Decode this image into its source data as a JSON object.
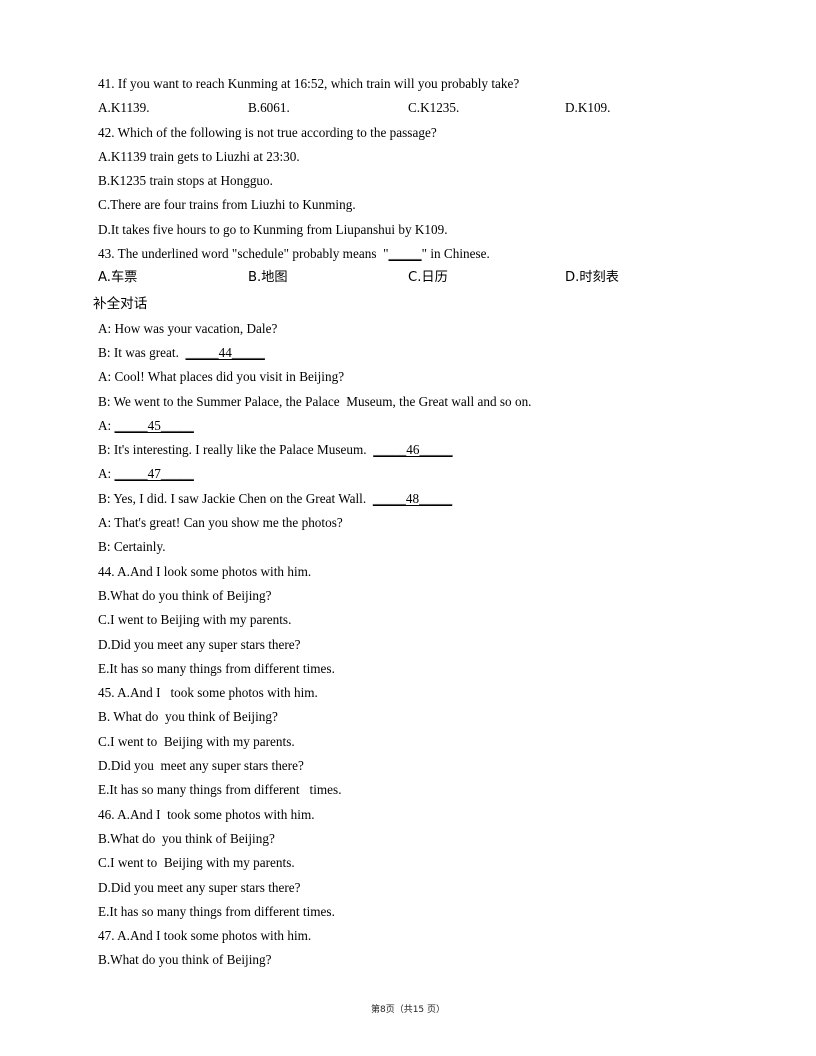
{
  "document": {
    "footer": "第8页（共15 页）"
  },
  "questions": {
    "q41": {
      "stem": "41. If you want to reach Kunming at 16:52, which train will you probably take?",
      "options": [
        "A.K1139.",
        "B.6061.",
        "C.K1235.",
        "D.K109."
      ]
    },
    "q42": {
      "stem": "42. Which of the following is not true according to the passage?",
      "options": [
        "A.K1139 train gets to Liuzhi at 23:30.",
        "B.K1235 train stops at Hongguo.",
        "C.There are four trains from Liuzhi to Kunming.",
        "D.It takes five hours to go to Kunming from Liupanshui by K109."
      ]
    },
    "q43": {
      "stem_before": "43. The underlined word \"schedule\" probably means  \"",
      "stem_blank": "_____",
      "stem_after": "\" in Chinese.",
      "options": [
        "A.车票",
        "B.地图",
        "C.日历",
        "D.时刻表"
      ]
    }
  },
  "section": {
    "heading": "补全对话"
  },
  "dialogue": [
    {
      "text": "A: How was your vacation, Dale?"
    },
    {
      "text": "B: It was great.  ",
      "blank": "_____44_____"
    },
    {
      "text": "A: Cool! What places did you visit in Beijing?"
    },
    {
      "text": "B: We went to the Summer Palace, the Palace  Museum, the Great wall and so on."
    },
    {
      "text": "A: ",
      "blank": "_____45_____"
    },
    {
      "text": "B: It's interesting. I really like the Palace Museum.  ",
      "blank": "_____46_____"
    },
    {
      "text": "A: ",
      "blank": "_____47_____"
    },
    {
      "text": "B: Yes, I did. I saw Jackie Chen on the Great Wall.  ",
      "blank": "_____48_____"
    },
    {
      "text": "A: That's great! Can you show me the photos?"
    },
    {
      "text": "B: Certainly."
    }
  ],
  "choice_groups": [
    {
      "items": [
        "44. A.And I look some photos with him.",
        "B.What do you think of Beijing?",
        "C.I went to Beijing with my parents.",
        "D.Did you meet any super stars there?",
        "E.It has so many things from different times."
      ]
    },
    {
      "items": [
        "45. A.And I   took some photos with him.",
        "B. What do  you think of Beijing?",
        "C.I went to  Beijing with my parents.",
        "D.Did you  meet any super stars there?",
        "E.It has so many things from different   times."
      ]
    },
    {
      "items": [
        "46. A.And I  took some photos with him.",
        "B.What do  you think of Beijing?",
        "C.I went to  Beijing with my parents.",
        "D.Did you meet any super stars there?",
        "E.It has so many things from different times."
      ]
    },
    {
      "items": [
        "47. A.And I took some photos with him.",
        "B.What do you think of Beijing?"
      ]
    }
  ]
}
